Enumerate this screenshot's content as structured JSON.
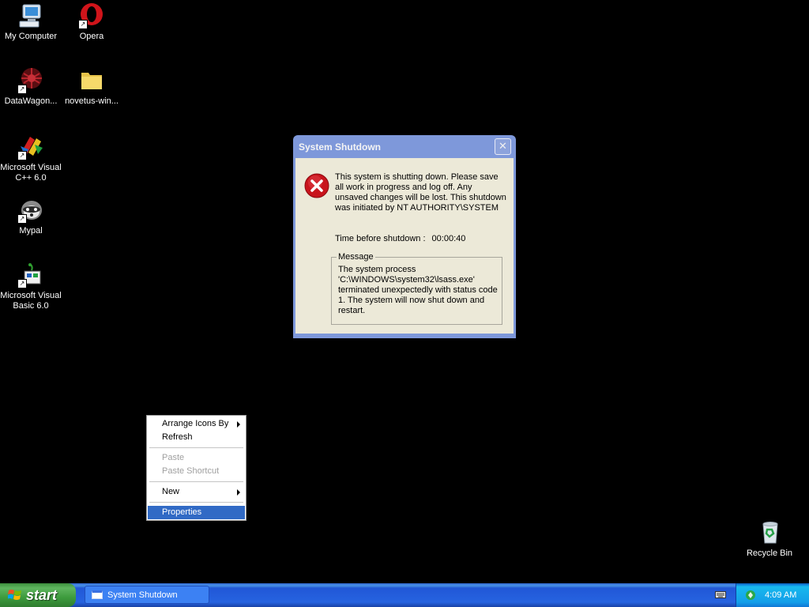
{
  "desktop": {
    "icons": [
      {
        "label": "My Computer",
        "icon": "my-computer-icon"
      },
      {
        "label": "Opera",
        "icon": "opera-icon"
      },
      {
        "label": "DataWagon...",
        "icon": "datawagon-icon"
      },
      {
        "label": "novetus-win...",
        "icon": "folder-icon"
      },
      {
        "label": "Microsoft Visual C++ 6.0",
        "icon": "visual-cpp-icon"
      },
      {
        "label": "Mypal",
        "icon": "mypal-icon"
      },
      {
        "label": "Microsoft Visual Basic 6.0",
        "icon": "visual-basic-icon"
      },
      {
        "label": "Recycle Bin",
        "icon": "recycle-bin-icon"
      }
    ]
  },
  "dialog": {
    "title": "System Shutdown",
    "close_label": "✕",
    "message": "This system is shutting down. Please save all work in progress and log off. Any unsaved changes will be lost. This shutdown was initiated by NT AUTHORITY\\SYSTEM",
    "time_label": "Time before shutdown :",
    "time_value": "00:00:40",
    "group_label": "Message",
    "group_text": "The system process 'C:\\WINDOWS\\system32\\lsass.exe' terminated unexpectedly with status code 1.  The system will now shut down and restart."
  },
  "context_menu": {
    "items": [
      {
        "label": "Arrange Icons By"
      },
      {
        "label": "Refresh"
      },
      {
        "label": "Paste"
      },
      {
        "label": "Paste Shortcut"
      },
      {
        "label": "New"
      },
      {
        "label": "Properties"
      }
    ]
  },
  "taskbar": {
    "start_label": "start",
    "task_label": "System Shutdown",
    "clock": "4:09 AM"
  },
  "colors": {
    "menu_highlight": "#316ac5",
    "dialog_frame": "#7e98da",
    "taskbar_blue": "#2663e0"
  }
}
